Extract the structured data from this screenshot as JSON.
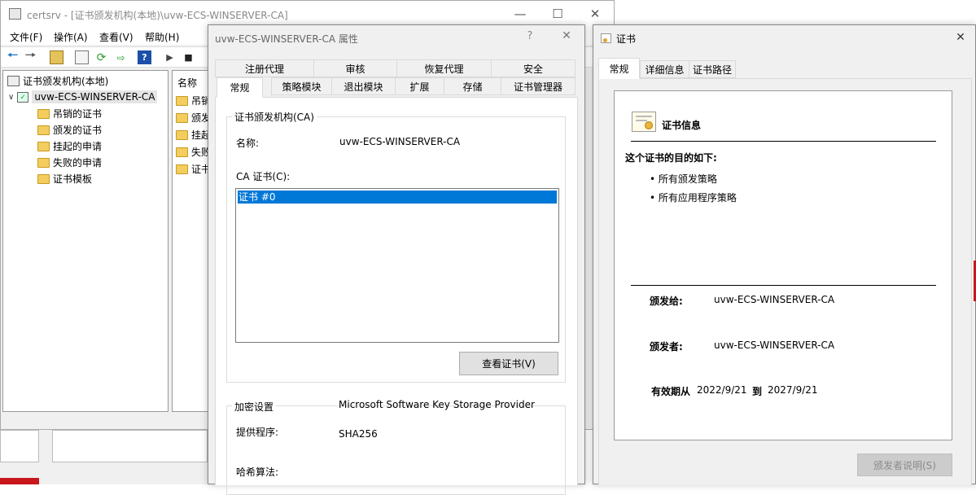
{
  "mmc": {
    "title": "certsrv - [证书颁发机构(本地)\\uvw-ECS-WINSERVER-CA]",
    "menu": [
      "文件(F)",
      "操作(A)",
      "查看(V)",
      "帮助(H)"
    ],
    "tree": {
      "root": "证书颁发机构(本地)",
      "ca": "uvw-ECS-WINSERVER-CA",
      "children": [
        "吊销的证书",
        "颁发的证书",
        "挂起的申请",
        "失败的申请",
        "证书模板"
      ]
    },
    "list": {
      "header": "名称",
      "items": [
        "吊销",
        "颁发",
        "挂起",
        "失败",
        "证书"
      ]
    }
  },
  "props": {
    "title": "uvw-ECS-WINSERVER-CA 属性",
    "help": "?",
    "tabs_row1": [
      "注册代理",
      "审核",
      "恢复代理",
      "安全"
    ],
    "tabs_row2": [
      "常规",
      "策略模块",
      "退出模块",
      "扩展",
      "存储",
      "证书管理器"
    ],
    "ca_group": "证书颁发机构(CA)",
    "name_label": "名称:",
    "name_value": "uvw-ECS-WINSERVER-CA",
    "ca_cert_label": "CA 证书(C):",
    "cert_item": "证书 #0",
    "view_cert": "查看证书(V)",
    "crypto_group": "加密设置",
    "provider_label": "提供程序:",
    "provider_value": "Microsoft Software Key Storage Provider",
    "hash_label": "哈希算法:",
    "hash_value": "SHA256"
  },
  "cert": {
    "title": "证书",
    "tabs": [
      "常规",
      "详细信息",
      "证书路径"
    ],
    "info_title": "证书信息",
    "purpose_title": "这个证书的目的如下:",
    "purposes": [
      "• 所有颁发策略",
      "• 所有应用程序策略"
    ],
    "issued_to_label": "颁发给:",
    "issued_to": "uvw-ECS-WINSERVER-CA",
    "issued_by_label": "颁发者:",
    "issued_by": "uvw-ECS-WINSERVER-CA",
    "validity_from_label": "有效期从",
    "valid_from": "2022/9/21",
    "to_label": "到",
    "valid_to": "2027/9/21",
    "issuer_statement": "颁发者说明(S)"
  }
}
